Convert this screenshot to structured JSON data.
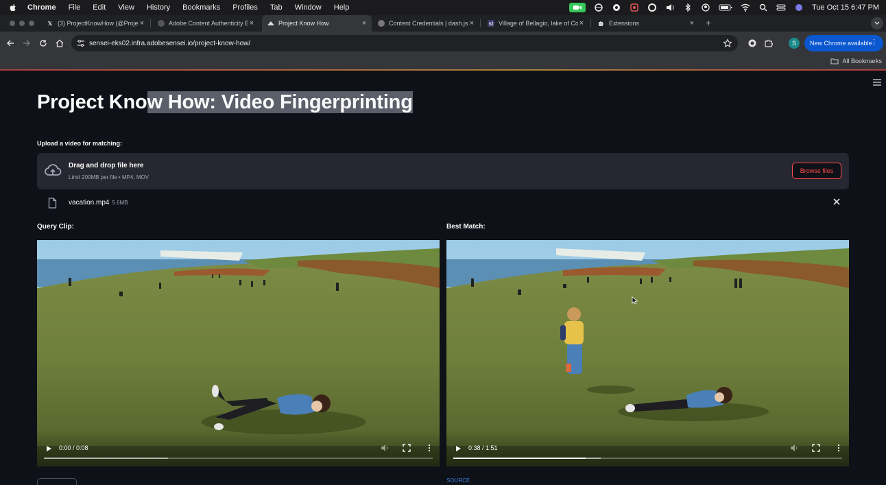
{
  "menubar": {
    "app": "Chrome",
    "items": [
      "File",
      "Edit",
      "View",
      "History",
      "Bookmarks",
      "Profiles",
      "Tab",
      "Window",
      "Help"
    ],
    "clock": "Tue Oct 15  6:47 PM"
  },
  "tabs": [
    {
      "title": "(3) ProjectKnowHow (@Proje",
      "favicon": "x-logo-icon"
    },
    {
      "title": "Adobe Content Authenticity E",
      "favicon": "adobe-icon"
    },
    {
      "title": "Project Know How",
      "favicon": "streamlit-icon",
      "active": true
    },
    {
      "title": "Content Credentials | dash.js",
      "favicon": "cr-icon"
    },
    {
      "title": "Village of Bellagio, lake of Co",
      "favicon": "site-icon"
    },
    {
      "title": "Extensions",
      "favicon": "puzzle-icon"
    }
  ],
  "toolbar": {
    "url": "sensei-eks02.infra.adobesensei.io/project-know-how/",
    "avatar_letter": "S",
    "update_label": "New Chrome available"
  },
  "bookmarks": {
    "all_label": "All Bookmarks"
  },
  "page": {
    "title_plain": "Project Kno",
    "title_highlighted": "w How: Video Fingerprinting",
    "upload_label": "Upload a video for matching:",
    "dropzone": {
      "primary": "Drag and drop file here",
      "secondary": "Limit 200MB per file • MP4, MOV",
      "browse_label": "Browse files"
    },
    "file": {
      "name": "vacation.mp4",
      "size": "5.6MB"
    },
    "query_label": "Query Clip:",
    "match_label": "Best Match:",
    "query_video": {
      "time": "0:00 / 0:08",
      "progress": 0.0,
      "buffered": 0.32
    },
    "match_video": {
      "time": "0:38 / 1:51",
      "progress": 0.34,
      "buffered": 0.38
    },
    "source_link": "SOURCE"
  },
  "colors": {
    "accent": "#ff4b4b",
    "background": "#0e1117",
    "panel": "#262730",
    "chrome_blue": "#0b57d0"
  }
}
